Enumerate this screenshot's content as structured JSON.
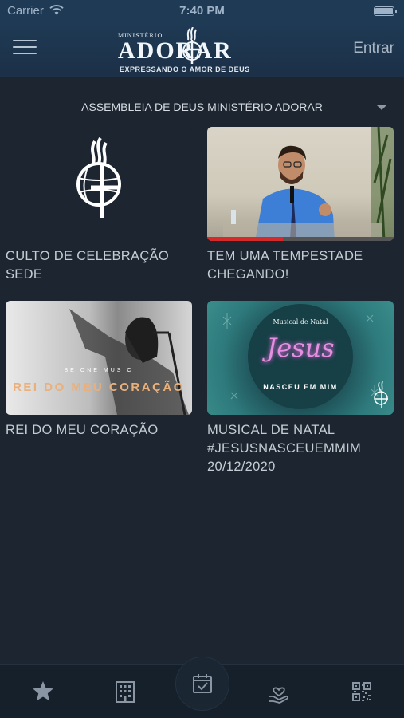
{
  "status_bar": {
    "carrier": "Carrier",
    "time": "7:40 PM"
  },
  "header": {
    "logo": {
      "top": "MINISTÉRIO",
      "word": "ADORAR",
      "sub": "EXPRESSANDO O AMOR DE DEUS"
    },
    "login_label": "Entrar"
  },
  "selector": {
    "label": "ASSEMBLEIA DE DEUS MINISTÉRIO ADORAR"
  },
  "cards": [
    {
      "title": "CULTO DE CELEBRAÇÃO SEDE"
    },
    {
      "title": "TEM UMA TEMPESTADE CHEGANDO!"
    },
    {
      "title": "REI DO MEU CORAÇÃO",
      "thumb_text_small": "BE ONE MUSIC",
      "thumb_text": "REI DO MEU CORAÇÃO"
    },
    {
      "title": "MUSICAL DE NATAL #JESUSNASCEUEMMIM 20/12/2020",
      "thumb_script_top": "Musical de Natal",
      "thumb_script": "Jesus",
      "thumb_text": "NASCEU EM MIM"
    }
  ],
  "tabbar": {
    "items": [
      "star-icon",
      "building-icon",
      "calendar-check-icon",
      "hand-heart-icon",
      "qr-code-icon"
    ]
  }
}
